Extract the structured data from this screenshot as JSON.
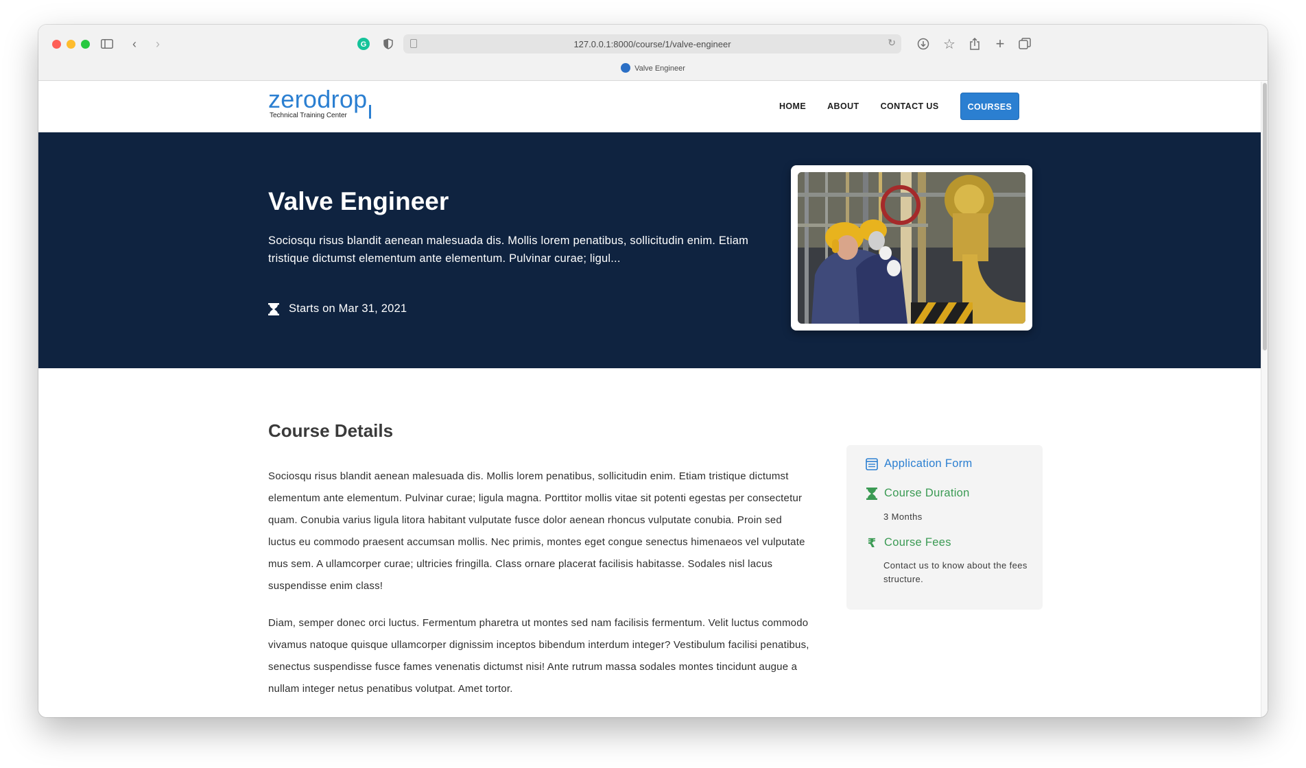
{
  "browser": {
    "url": "127.0.0.1:8000/course/1/valve-engineer",
    "tab_title": "Valve Engineer"
  },
  "nav": {
    "logo_word": "zerodrop",
    "logo_sub": "Technical Training Center",
    "links": [
      "HOME",
      "ABOUT",
      "CONTACT US"
    ],
    "active_button": "COURSES"
  },
  "hero": {
    "title": "Valve Engineer",
    "description": "Sociosqu risus blandit aenean malesuada dis. Mollis lorem penatibus, sollicitudin enim. Etiam tristique dictumst elementum ante elementum. Pulvinar curae; ligul...",
    "start_date": "Starts on Mar 31, 2021"
  },
  "details": {
    "title": "Course Details",
    "paragraph1": "Sociosqu risus blandit aenean malesuada dis. Mollis lorem penatibus, sollicitudin enim. Etiam tristique dictumst elementum ante elementum. Pulvinar curae; ligula magna. Porttitor mollis vitae sit potenti egestas per consectetur quam. Conubia varius ligula litora habitant vulputate fusce dolor aenean rhoncus vulputate conubia. Proin sed luctus eu commodo praesent accumsan mollis. Nec primis, montes eget congue senectus himenaeos vel vulputate mus sem. A ullamcorper curae; ultricies fringilla. Class ornare placerat facilisis habitasse. Sodales nisl lacus suspendisse enim class!",
    "paragraph2": "Diam, semper donec orci luctus. Fermentum pharetra ut montes sed nam facilisis fermentum. Velit luctus commodo vivamus natoque quisque ullamcorper dignissim inceptos bibendum interdum integer? Vestibulum facilisi penatibus, senectus suspendisse fusce fames venenatis dictumst nisi! Ante rutrum massa sodales montes tincidunt augue a nullam integer netus penatibus volutpat. Amet tortor."
  },
  "sidebar": {
    "application_form": "Application Form",
    "duration_label": "Course Duration",
    "duration_value": "3 Months",
    "fees_label": "Course Fees",
    "fees_value": "Contact us to know about the fees structure."
  },
  "colors": {
    "brand_blue": "#2b7fd1",
    "hero_navy": "#0f2340",
    "accent_green": "#3a9a53"
  }
}
